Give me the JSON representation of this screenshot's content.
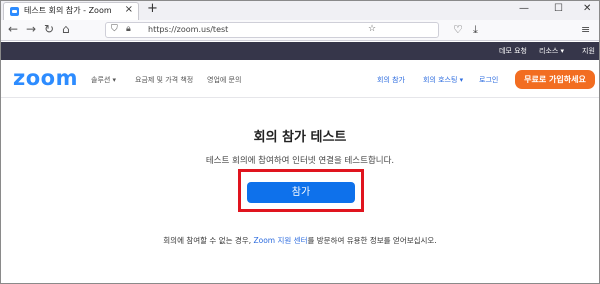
{
  "browser": {
    "tab_title": "테스트 회의 참가 - Zoom",
    "tab_close_icon": "×",
    "new_tab_icon": "+",
    "minimize_icon": "—",
    "maximize_icon": "☐",
    "close_icon": "✕",
    "back_icon": "←",
    "forward_icon": "→",
    "reload_icon": "↻",
    "home_icon": "⌂",
    "url": "https://zoom.us/test",
    "url_bar_right_icons": [
      "☆",
      "♡",
      "⤓"
    ],
    "menu_icon": "≡"
  },
  "topbar": {
    "demo": "데모 요청",
    "resources": "리소스 ▾",
    "support": "지원"
  },
  "header": {
    "logo": "zoom",
    "solutions": "솔루션 ▾",
    "pricing": "요금제 및 가격 책정",
    "contact_sales": "영업에 문의",
    "join_meeting": "회의 참가",
    "host_meeting": "회의 호스팅 ▾",
    "login": "로그인",
    "signup": "무료로 가입하세요"
  },
  "main": {
    "title": "회의 참가 테스트",
    "description": "테스트 회의에 참여하여 인터넷 연결을 테스트합니다.",
    "join_button": "참가",
    "footer_before": "회의에 참여할 수 없는 경우, ",
    "footer_link": "Zoom 지원 센터",
    "footer_after": "를 방문하여 유용한 정보를 얻어보십시오."
  },
  "colors": {
    "brand": "#2d8cff",
    "join_button": "#0e71eb",
    "signup_button": "#f26d21",
    "highlight": "#e0141e",
    "top_strip": "#36364a"
  }
}
